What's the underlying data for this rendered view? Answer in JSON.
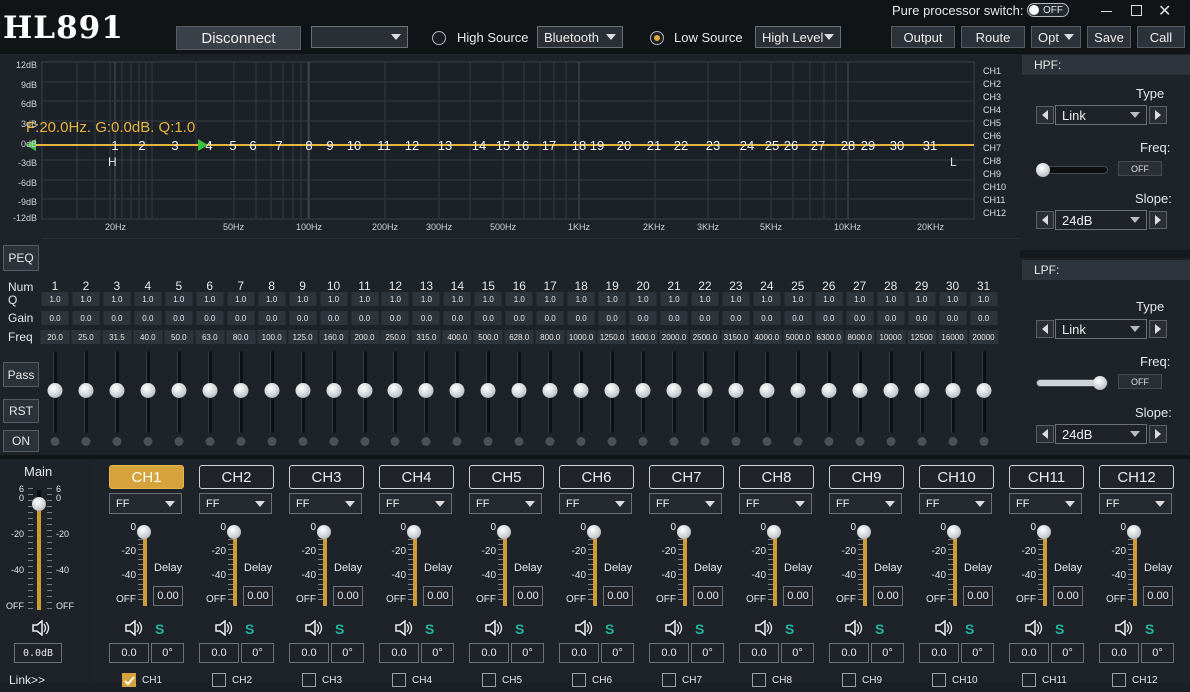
{
  "app": {
    "title": "HL891"
  },
  "header": {
    "disconnect": "Disconnect",
    "device_select": "",
    "high_source_label": "High Source",
    "high_source_value": "Bluetooth",
    "low_source_label": "Low Source",
    "low_source_value": "High Level",
    "pure_processor_label": "Pure processor switch:",
    "pure_processor_value": "OFF",
    "output": "Output",
    "route": "Route",
    "opt": "Opt",
    "save": "Save",
    "call": "Call"
  },
  "graph": {
    "y_ticks": [
      "12dB",
      "9dB",
      "6dB",
      "3dB",
      "0dB",
      "-3dB",
      "-6dB",
      "-9dB",
      "-12dB"
    ],
    "x_ticks": [
      "20Hz",
      "50Hz",
      "100Hz",
      "200Hz",
      "300Hz",
      "500Hz",
      "1KHz",
      "2KHz",
      "3KHz",
      "5KHz",
      "10KHz",
      "20KHz"
    ],
    "info": "F:20.0Hz. G:0.0dB. Q:1.0",
    "h_marker": "H",
    "l_marker": "L",
    "channels": [
      "CH1",
      "CH2",
      "CH3",
      "CH4",
      "CH5",
      "CH6",
      "CH7",
      "CH8",
      "CH9",
      "CH10",
      "CH11",
      "CH12"
    ],
    "bands": [
      "1",
      "2",
      "3",
      "4",
      "5",
      "6",
      "7",
      "8",
      "9",
      "10",
      "11",
      "12",
      "13",
      "14",
      "15",
      "16",
      "17",
      "18",
      "19",
      "20",
      "21",
      "22",
      "23",
      "24",
      "25",
      "26",
      "27",
      "28",
      "29",
      "30",
      "31"
    ]
  },
  "peq": {
    "peq_label": "PEQ",
    "row_labels": {
      "num": "Num",
      "q": "Q",
      "gain": "Gain",
      "freq": "Freq"
    },
    "nums": [
      "1",
      "2",
      "3",
      "4",
      "5",
      "6",
      "7",
      "8",
      "9",
      "10",
      "11",
      "12",
      "13",
      "14",
      "15",
      "16",
      "17",
      "18",
      "19",
      "20",
      "21",
      "22",
      "23",
      "24",
      "25",
      "26",
      "27",
      "28",
      "29",
      "30",
      "31"
    ],
    "q": [
      "1.0",
      "1.0",
      "1.0",
      "1.0",
      "1.0",
      "1.0",
      "1.0",
      "1.0",
      "1.0",
      "1.0",
      "1.0",
      "1.0",
      "1.0",
      "1.0",
      "1.0",
      "1.0",
      "1.0",
      "1.0",
      "1.0",
      "1.0",
      "1.0",
      "1.0",
      "1.0",
      "1.0",
      "1.0",
      "1.0",
      "1.0",
      "1.0",
      "1.0",
      "1.0",
      "1.0"
    ],
    "gain": [
      "0.0",
      "0.0",
      "0.0",
      "0.0",
      "0.0",
      "0.0",
      "0.0",
      "0.0",
      "0.0",
      "0.0",
      "0.0",
      "0.0",
      "0.0",
      "0.0",
      "0.0",
      "0.0",
      "0.0",
      "0.0",
      "0.0",
      "0.0",
      "0.0",
      "0.0",
      "0.0",
      "0.0",
      "0.0",
      "0.0",
      "0.0",
      "0.0",
      "0.0",
      "0.0",
      "0.0"
    ],
    "freq": [
      "20.0",
      "25.0",
      "31.5",
      "40.0",
      "50.0",
      "63.0",
      "80.0",
      "100.0",
      "125.0",
      "160.0",
      "200.0",
      "250.0",
      "315.0",
      "400.0",
      "500.0",
      "628.0",
      "800.0",
      "1000.0",
      "1250.0",
      "1600.0",
      "2000.0",
      "2500.0",
      "3150.0",
      "4000.0",
      "5000.0",
      "6300.0",
      "8000.0",
      "10000",
      "12500",
      "16000",
      "20000"
    ],
    "pass": "Pass",
    "rst": "RST",
    "on": "ON"
  },
  "hpf": {
    "title": "HPF:",
    "type_label": "Type",
    "type_value": "Link",
    "freq_label": "Freq:",
    "freq_toggle": "OFF",
    "slope_label": "Slope:",
    "slope_value": "24dB"
  },
  "lpf": {
    "title": "LPF:",
    "type_label": "Type",
    "type_value": "Link",
    "freq_label": "Freq:",
    "freq_toggle": "OFF",
    "slope_label": "Slope:",
    "slope_value": "24dB"
  },
  "main": {
    "label": "Main",
    "scale_left": [
      "6",
      "0",
      "-20",
      "-40",
      "OFF"
    ],
    "scale_right": [
      "6",
      "0",
      "-20",
      "-40",
      "OFF"
    ],
    "value": "0.0dB",
    "link": "Link>>"
  },
  "channels": [
    {
      "name": "CH1",
      "mode": "FF",
      "delay": "0.00",
      "level": "0.0",
      "phase": "0°",
      "check_label": "CH1",
      "checked": true
    },
    {
      "name": "CH2",
      "mode": "FF",
      "delay": "0.00",
      "level": "0.0",
      "phase": "0°",
      "check_label": "CH2",
      "checked": false
    },
    {
      "name": "CH3",
      "mode": "FF",
      "delay": "0.00",
      "level": "0.0",
      "phase": "0°",
      "check_label": "CH3",
      "checked": false
    },
    {
      "name": "CH4",
      "mode": "FF",
      "delay": "0.00",
      "level": "0.0",
      "phase": "0°",
      "check_label": "CH4",
      "checked": false
    },
    {
      "name": "CH5",
      "mode": "FF",
      "delay": "0.00",
      "level": "0.0",
      "phase": "0°",
      "check_label": "CH5",
      "checked": false
    },
    {
      "name": "CH6",
      "mode": "FF",
      "delay": "0.00",
      "level": "0.0",
      "phase": "0°",
      "check_label": "CH6",
      "checked": false
    },
    {
      "name": "CH7",
      "mode": "FF",
      "delay": "0.00",
      "level": "0.0",
      "phase": "0°",
      "check_label": "CH7",
      "checked": false
    },
    {
      "name": "CH8",
      "mode": "FF",
      "delay": "0.00",
      "level": "0.0",
      "phase": "0°",
      "check_label": "CH8",
      "checked": false
    },
    {
      "name": "CH9",
      "mode": "FF",
      "delay": "0.00",
      "level": "0.0",
      "phase": "0°",
      "check_label": "CH9",
      "checked": false
    },
    {
      "name": "CH10",
      "mode": "FF",
      "delay": "0.00",
      "level": "0.0",
      "phase": "0°",
      "check_label": "CH10",
      "checked": false
    },
    {
      "name": "CH11",
      "mode": "FF",
      "delay": "0.00",
      "level": "0.0",
      "phase": "0°",
      "check_label": "CH11",
      "checked": false
    },
    {
      "name": "CH12",
      "mode": "FF",
      "delay": "0.00",
      "level": "0.0",
      "phase": "0°",
      "check_label": "CH12",
      "checked": false
    }
  ],
  "channel_strip_labels": {
    "scale": [
      "0",
      "-20",
      "-40",
      "OFF"
    ],
    "delay": "Delay",
    "solo": "S"
  },
  "colors": {
    "accent": "#d5a23b",
    "eq_line": "#e7b53c",
    "marker_green": "#39c23a",
    "solo": "#1fb5a0"
  }
}
